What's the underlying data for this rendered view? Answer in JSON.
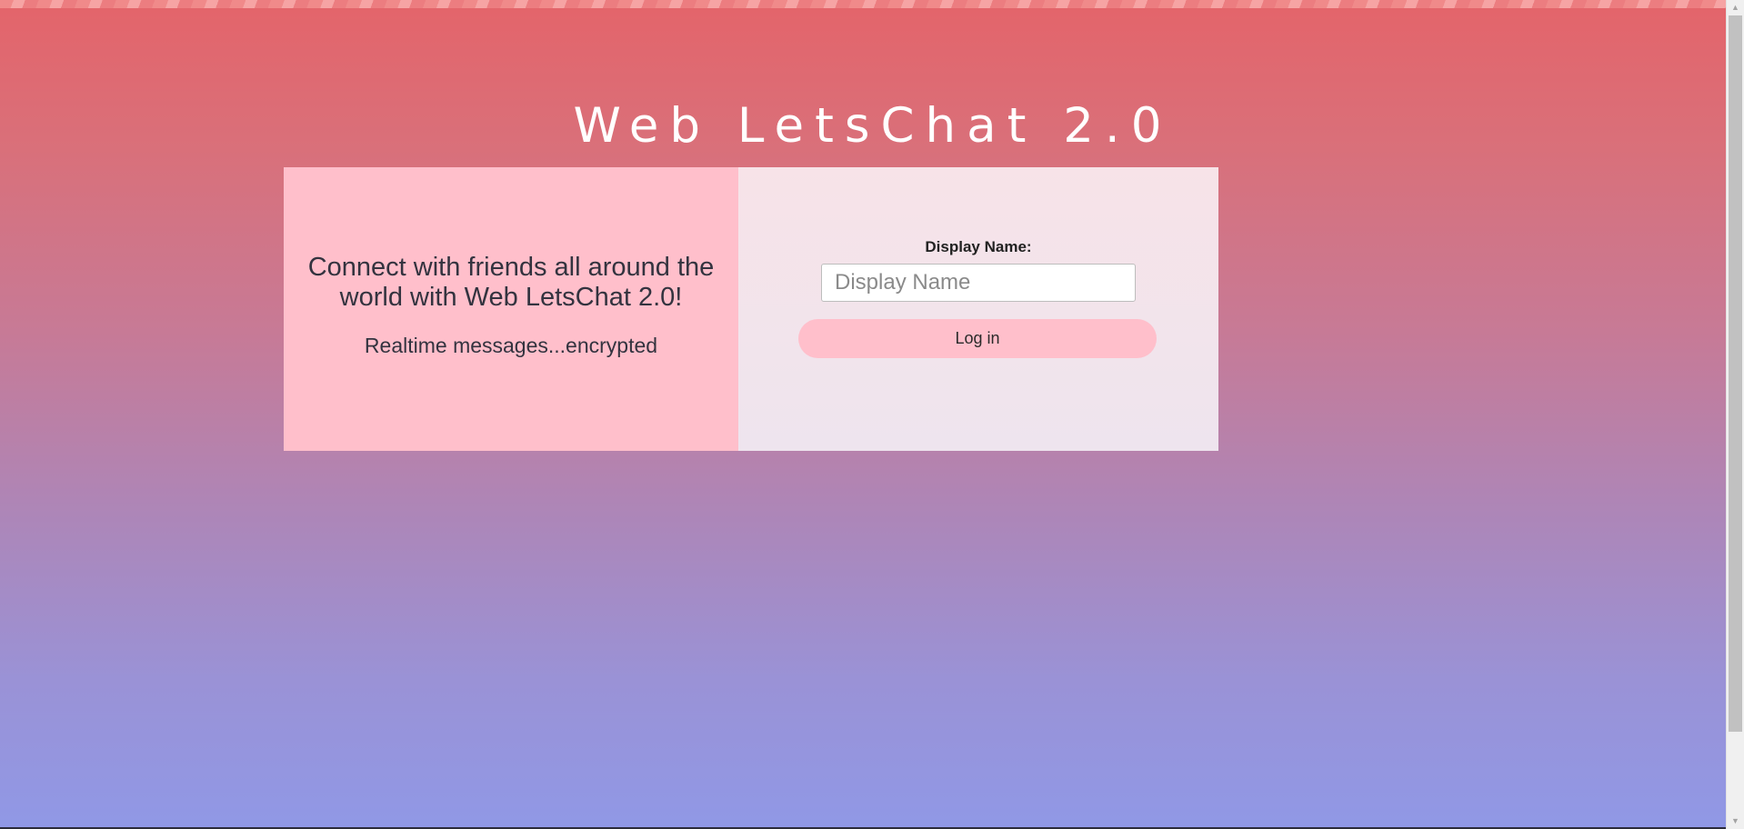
{
  "header": {
    "title": "Web LetsChat 2.0"
  },
  "intro": {
    "tagline": "Connect with friends all around the world with Web LetsChat 2.0!",
    "subtag": "Realtime messages...encrypted"
  },
  "login": {
    "label": "Display Name:",
    "placeholder": "Display Name",
    "value": "",
    "button_label": "Log in"
  },
  "scrollbar": {
    "up_icon": "chevron-up-icon",
    "down_icon": "chevron-down-icon"
  },
  "colors": {
    "background_top": "#e4646a",
    "background_bottom": "#9098e6",
    "left_panel": "#ffbfcb",
    "right_panel": "#f7e3e8",
    "button": "#ffbfcb"
  }
}
